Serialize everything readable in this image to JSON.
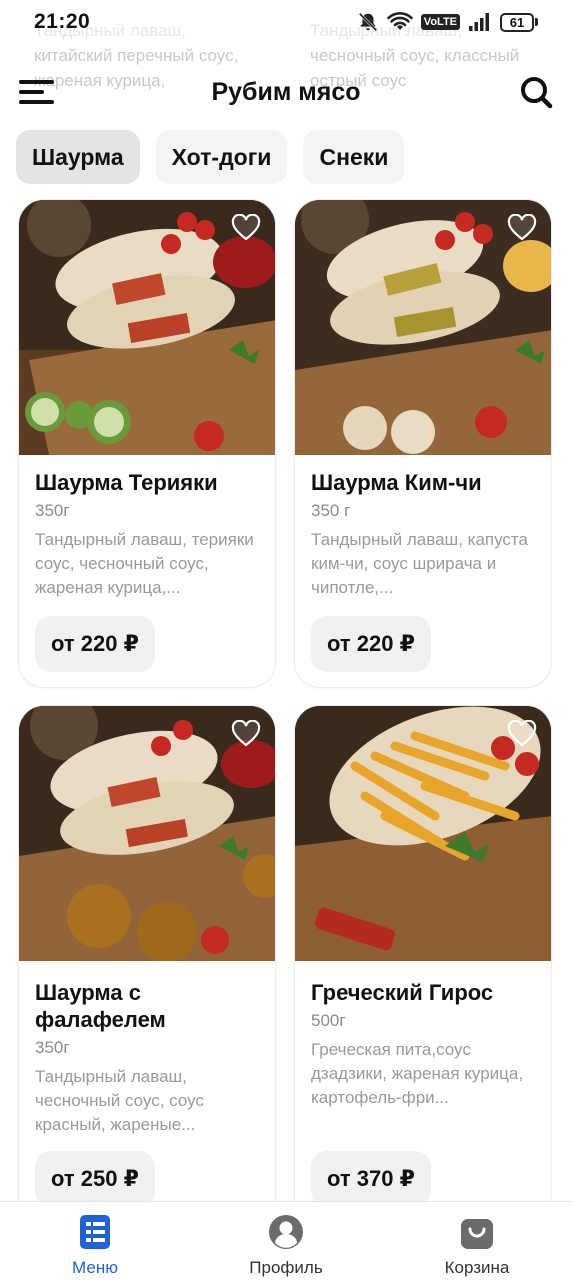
{
  "status_bar": {
    "time": "21:20",
    "volte": "VoLTE",
    "battery": "61"
  },
  "background_peek": {
    "left_text": "Тандырный лаваш, китайский перечный соус, жареная курица,",
    "right_text": "Тандырный лаваш, чесночный соус, классный острый соус"
  },
  "header": {
    "title": "Рубим мясо"
  },
  "tabs": [
    {
      "label": "Шаурма",
      "active": true
    },
    {
      "label": "Хот-доги",
      "active": false
    },
    {
      "label": "Снеки",
      "active": false
    }
  ],
  "products": [
    {
      "title": "Шаурма Терияки",
      "weight": "350г",
      "description": "Тандырный лаваш, терияки соус, чесночный соус, жареная курица,...",
      "price": "от 220 ₽"
    },
    {
      "title": "Шаурма Ким-чи",
      "weight": "350 г",
      "description": "Тандырный лаваш, капуста ким-чи, соус шрирача и чипотле,...",
      "price": "от 220 ₽"
    },
    {
      "title": "Шаурма с фалафелем",
      "weight": "350г",
      "description": "Тандырный лаваш, чесночный соус, соус красный, жареные...",
      "price": "от 250 ₽"
    },
    {
      "title": "Греческий Гирос",
      "weight": "500г",
      "description": "Греческая пита,соус дзадзики, жареная курица, картофель-фри...",
      "price": "от 370 ₽"
    }
  ],
  "bottom_nav": [
    {
      "label": "Меню",
      "icon": "menu-list-icon",
      "active": true
    },
    {
      "label": "Профиль",
      "icon": "profile-icon",
      "active": false
    },
    {
      "label": "Корзина",
      "icon": "cart-bag-icon",
      "active": false
    }
  ],
  "colors": {
    "accent": "#1e63d6",
    "tab_active": "#e4e4e4",
    "price_bg": "#f1f1f1"
  }
}
